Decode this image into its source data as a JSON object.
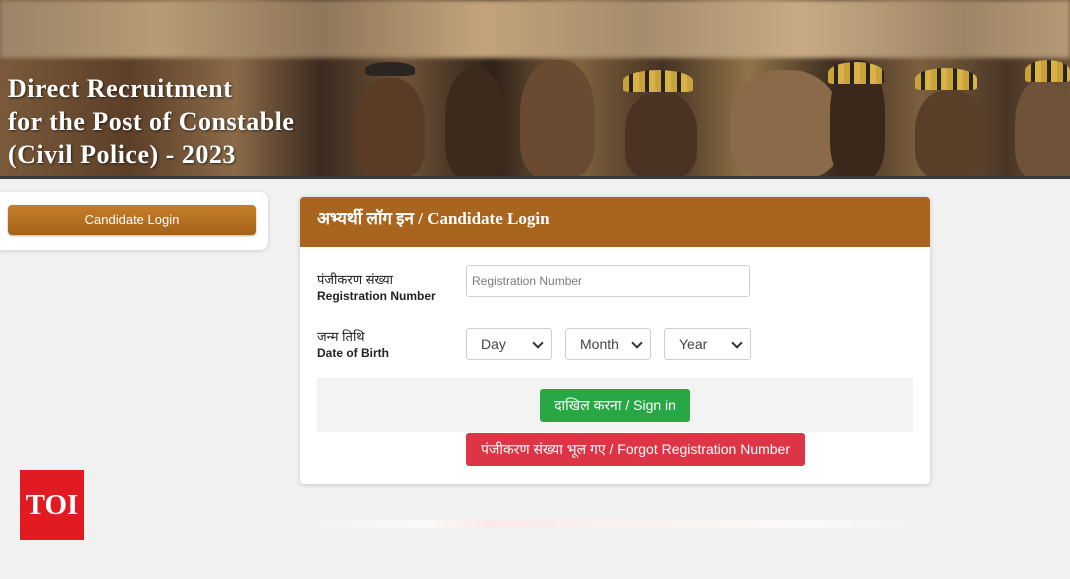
{
  "banner": {
    "title_lines": [
      "Direct Recruitment",
      "for the Post of Constable",
      "(Civil Police) - 2023"
    ]
  },
  "sidebar": {
    "candidate_login_label": "Candidate Login"
  },
  "login_card": {
    "title": "अभ्यर्थी लॉग इन / Candidate Login",
    "registration": {
      "label_hi": "पंजीकरण संख्या",
      "label_en": "Registration Number",
      "value": "",
      "placeholder": "Registration Number"
    },
    "dob": {
      "label_hi": "जन्म तिथि",
      "label_en": "Date of Birth",
      "day_selected": "Day",
      "month_selected": "Month",
      "year_selected": "Year"
    },
    "signin_label": "दाखिल करना / Sign in",
    "forgot_label": "पंजीकरण संख्या भूल गए / Forgot Registration Number"
  },
  "watermark": {
    "logo_text": "TOI"
  },
  "colors": {
    "header_brown": "#a9651e",
    "signin_green": "#28a745",
    "forgot_red": "#dc3545",
    "toi_red": "#e21b23"
  }
}
